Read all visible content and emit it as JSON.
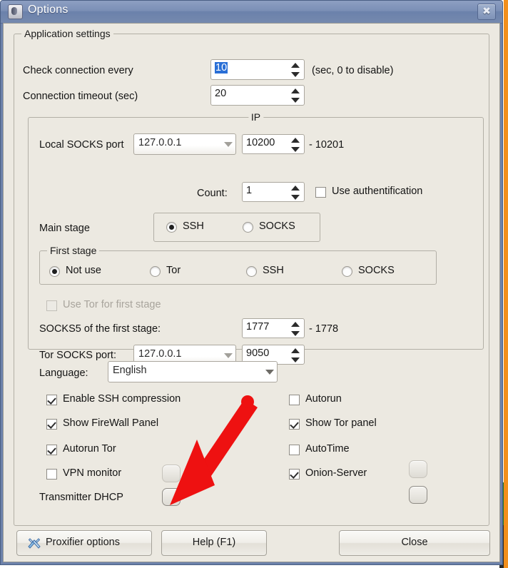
{
  "window": {
    "title": "Options",
    "icon": "app-icon",
    "close_label": "✖"
  },
  "application_settings": {
    "legend": "Application settings",
    "check_connection": {
      "label": "Check connection every",
      "value": "10",
      "hint": "(sec, 0 to disable)"
    },
    "connection_timeout": {
      "label": "Connection timeout (sec)",
      "value": "20"
    }
  },
  "ip_group": {
    "legend": "IP",
    "local_socks": {
      "label": "Local SOCKS port",
      "host": "127.0.0.1",
      "port": "10200",
      "range_suffix": "- 10201"
    },
    "count": {
      "label": "Count:",
      "value": "1"
    },
    "use_authentification": {
      "label": "Use authentification",
      "checked": false
    },
    "main_stage": {
      "label": "Main stage",
      "options": [
        "SSH",
        "SOCKS"
      ],
      "selected": "SSH"
    },
    "first_stage": {
      "legend": "First stage",
      "options": [
        "Not use",
        "Tor",
        "SSH",
        "SOCKS"
      ],
      "selected": "Not use"
    },
    "use_tor_first_stage": {
      "label": "Use Tor for first stage",
      "checked": false,
      "disabled": true
    },
    "socks5_first_stage": {
      "label": "SOCKS5 of the first stage:",
      "value": "1777",
      "range_suffix": "- 1778"
    },
    "tor_socks_port": {
      "label": "Tor SOCKS port:",
      "host": "127.0.0.1",
      "port": "9050"
    }
  },
  "language": {
    "label": "Language:",
    "value": "English"
  },
  "options_left": [
    {
      "label": "Enable SSH compression",
      "checked": true,
      "toggle": false
    },
    {
      "label": "Show FireWall Panel",
      "checked": true,
      "toggle": false
    },
    {
      "label": "Autorun Tor",
      "checked": true,
      "toggle": false
    },
    {
      "label": "VPN monitor",
      "checked": false,
      "toggle": true
    }
  ],
  "options_right": [
    {
      "label": "Autorun",
      "checked": false,
      "toggle": false
    },
    {
      "label": "Show Tor panel",
      "checked": true,
      "toggle": false
    },
    {
      "label": "AutoTime",
      "checked": false,
      "toggle": true
    },
    {
      "label": "Onion-Server",
      "checked": true,
      "toggle": true
    }
  ],
  "transmitter_dhcp": {
    "label": "Transmitter DHCP",
    "toggle": true
  },
  "buttons": {
    "proxifier": "Proxifier options",
    "help": "Help (F1)",
    "close": "Close"
  },
  "annotation": {
    "type": "red-arrow",
    "points_to": "transmitter-dhcp-toggle",
    "color": "#ee1111"
  }
}
